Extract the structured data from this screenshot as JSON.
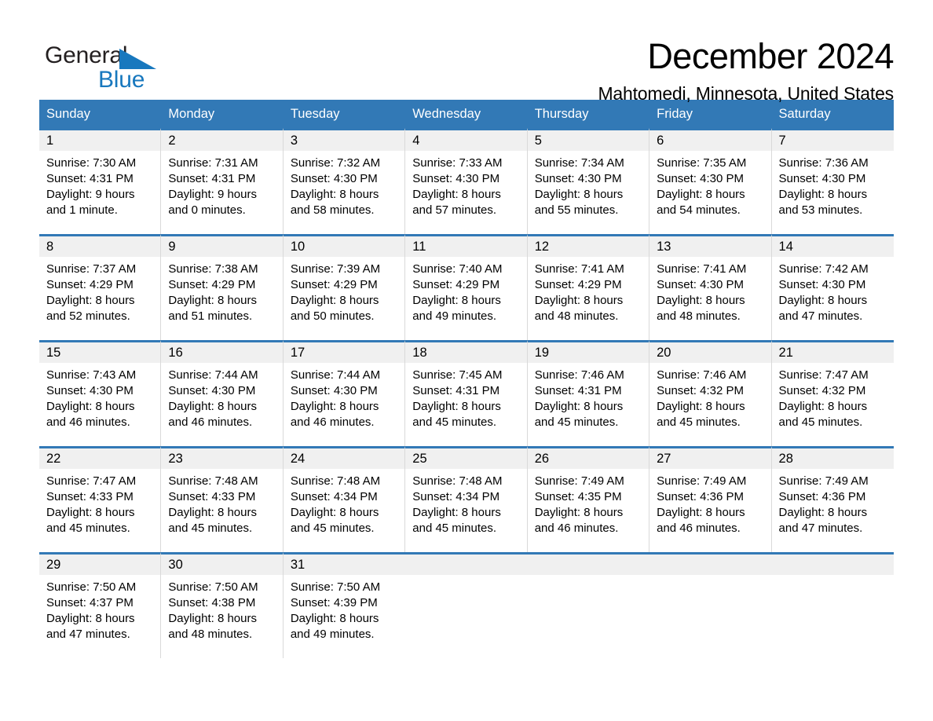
{
  "brand": {
    "name_part1": "General",
    "name_part2": "Blue",
    "logo_icon": "triangle-icon",
    "accent_color": "#1878be"
  },
  "header": {
    "month_title": "December 2024",
    "location": "Mahtomedi, Minnesota, United States"
  },
  "colors": {
    "header_blue": "#3279b6",
    "daynum_band": "#f0f0f0",
    "text": "#000000"
  },
  "calendar": {
    "weekday_headers": [
      "Sunday",
      "Monday",
      "Tuesday",
      "Wednesday",
      "Thursday",
      "Friday",
      "Saturday"
    ],
    "weeks": [
      [
        {
          "day": "1",
          "sunrise": "Sunrise: 7:30 AM",
          "sunset": "Sunset: 4:31 PM",
          "daylight_line1": "Daylight: 9 hours",
          "daylight_line2": "and 1 minute."
        },
        {
          "day": "2",
          "sunrise": "Sunrise: 7:31 AM",
          "sunset": "Sunset: 4:31 PM",
          "daylight_line1": "Daylight: 9 hours",
          "daylight_line2": "and 0 minutes."
        },
        {
          "day": "3",
          "sunrise": "Sunrise: 7:32 AM",
          "sunset": "Sunset: 4:30 PM",
          "daylight_line1": "Daylight: 8 hours",
          "daylight_line2": "and 58 minutes."
        },
        {
          "day": "4",
          "sunrise": "Sunrise: 7:33 AM",
          "sunset": "Sunset: 4:30 PM",
          "daylight_line1": "Daylight: 8 hours",
          "daylight_line2": "and 57 minutes."
        },
        {
          "day": "5",
          "sunrise": "Sunrise: 7:34 AM",
          "sunset": "Sunset: 4:30 PM",
          "daylight_line1": "Daylight: 8 hours",
          "daylight_line2": "and 55 minutes."
        },
        {
          "day": "6",
          "sunrise": "Sunrise: 7:35 AM",
          "sunset": "Sunset: 4:30 PM",
          "daylight_line1": "Daylight: 8 hours",
          "daylight_line2": "and 54 minutes."
        },
        {
          "day": "7",
          "sunrise": "Sunrise: 7:36 AM",
          "sunset": "Sunset: 4:30 PM",
          "daylight_line1": "Daylight: 8 hours",
          "daylight_line2": "and 53 minutes."
        }
      ],
      [
        {
          "day": "8",
          "sunrise": "Sunrise: 7:37 AM",
          "sunset": "Sunset: 4:29 PM",
          "daylight_line1": "Daylight: 8 hours",
          "daylight_line2": "and 52 minutes."
        },
        {
          "day": "9",
          "sunrise": "Sunrise: 7:38 AM",
          "sunset": "Sunset: 4:29 PM",
          "daylight_line1": "Daylight: 8 hours",
          "daylight_line2": "and 51 minutes."
        },
        {
          "day": "10",
          "sunrise": "Sunrise: 7:39 AM",
          "sunset": "Sunset: 4:29 PM",
          "daylight_line1": "Daylight: 8 hours",
          "daylight_line2": "and 50 minutes."
        },
        {
          "day": "11",
          "sunrise": "Sunrise: 7:40 AM",
          "sunset": "Sunset: 4:29 PM",
          "daylight_line1": "Daylight: 8 hours",
          "daylight_line2": "and 49 minutes."
        },
        {
          "day": "12",
          "sunrise": "Sunrise: 7:41 AM",
          "sunset": "Sunset: 4:29 PM",
          "daylight_line1": "Daylight: 8 hours",
          "daylight_line2": "and 48 minutes."
        },
        {
          "day": "13",
          "sunrise": "Sunrise: 7:41 AM",
          "sunset": "Sunset: 4:30 PM",
          "daylight_line1": "Daylight: 8 hours",
          "daylight_line2": "and 48 minutes."
        },
        {
          "day": "14",
          "sunrise": "Sunrise: 7:42 AM",
          "sunset": "Sunset: 4:30 PM",
          "daylight_line1": "Daylight: 8 hours",
          "daylight_line2": "and 47 minutes."
        }
      ],
      [
        {
          "day": "15",
          "sunrise": "Sunrise: 7:43 AM",
          "sunset": "Sunset: 4:30 PM",
          "daylight_line1": "Daylight: 8 hours",
          "daylight_line2": "and 46 minutes."
        },
        {
          "day": "16",
          "sunrise": "Sunrise: 7:44 AM",
          "sunset": "Sunset: 4:30 PM",
          "daylight_line1": "Daylight: 8 hours",
          "daylight_line2": "and 46 minutes."
        },
        {
          "day": "17",
          "sunrise": "Sunrise: 7:44 AM",
          "sunset": "Sunset: 4:30 PM",
          "daylight_line1": "Daylight: 8 hours",
          "daylight_line2": "and 46 minutes."
        },
        {
          "day": "18",
          "sunrise": "Sunrise: 7:45 AM",
          "sunset": "Sunset: 4:31 PM",
          "daylight_line1": "Daylight: 8 hours",
          "daylight_line2": "and 45 minutes."
        },
        {
          "day": "19",
          "sunrise": "Sunrise: 7:46 AM",
          "sunset": "Sunset: 4:31 PM",
          "daylight_line1": "Daylight: 8 hours",
          "daylight_line2": "and 45 minutes."
        },
        {
          "day": "20",
          "sunrise": "Sunrise: 7:46 AM",
          "sunset": "Sunset: 4:32 PM",
          "daylight_line1": "Daylight: 8 hours",
          "daylight_line2": "and 45 minutes."
        },
        {
          "day": "21",
          "sunrise": "Sunrise: 7:47 AM",
          "sunset": "Sunset: 4:32 PM",
          "daylight_line1": "Daylight: 8 hours",
          "daylight_line2": "and 45 minutes."
        }
      ],
      [
        {
          "day": "22",
          "sunrise": "Sunrise: 7:47 AM",
          "sunset": "Sunset: 4:33 PM",
          "daylight_line1": "Daylight: 8 hours",
          "daylight_line2": "and 45 minutes."
        },
        {
          "day": "23",
          "sunrise": "Sunrise: 7:48 AM",
          "sunset": "Sunset: 4:33 PM",
          "daylight_line1": "Daylight: 8 hours",
          "daylight_line2": "and 45 minutes."
        },
        {
          "day": "24",
          "sunrise": "Sunrise: 7:48 AM",
          "sunset": "Sunset: 4:34 PM",
          "daylight_line1": "Daylight: 8 hours",
          "daylight_line2": "and 45 minutes."
        },
        {
          "day": "25",
          "sunrise": "Sunrise: 7:48 AM",
          "sunset": "Sunset: 4:34 PM",
          "daylight_line1": "Daylight: 8 hours",
          "daylight_line2": "and 45 minutes."
        },
        {
          "day": "26",
          "sunrise": "Sunrise: 7:49 AM",
          "sunset": "Sunset: 4:35 PM",
          "daylight_line1": "Daylight: 8 hours",
          "daylight_line2": "and 46 minutes."
        },
        {
          "day": "27",
          "sunrise": "Sunrise: 7:49 AM",
          "sunset": "Sunset: 4:36 PM",
          "daylight_line1": "Daylight: 8 hours",
          "daylight_line2": "and 46 minutes."
        },
        {
          "day": "28",
          "sunrise": "Sunrise: 7:49 AM",
          "sunset": "Sunset: 4:36 PM",
          "daylight_line1": "Daylight: 8 hours",
          "daylight_line2": "and 47 minutes."
        }
      ],
      [
        {
          "day": "29",
          "sunrise": "Sunrise: 7:50 AM",
          "sunset": "Sunset: 4:37 PM",
          "daylight_line1": "Daylight: 8 hours",
          "daylight_line2": "and 47 minutes."
        },
        {
          "day": "30",
          "sunrise": "Sunrise: 7:50 AM",
          "sunset": "Sunset: 4:38 PM",
          "daylight_line1": "Daylight: 8 hours",
          "daylight_line2": "and 48 minutes."
        },
        {
          "day": "31",
          "sunrise": "Sunrise: 7:50 AM",
          "sunset": "Sunset: 4:39 PM",
          "daylight_line1": "Daylight: 8 hours",
          "daylight_line2": "and 49 minutes."
        },
        {
          "day": "",
          "sunrise": "",
          "sunset": "",
          "daylight_line1": "",
          "daylight_line2": ""
        },
        {
          "day": "",
          "sunrise": "",
          "sunset": "",
          "daylight_line1": "",
          "daylight_line2": ""
        },
        {
          "day": "",
          "sunrise": "",
          "sunset": "",
          "daylight_line1": "",
          "daylight_line2": ""
        },
        {
          "day": "",
          "sunrise": "",
          "sunset": "",
          "daylight_line1": "",
          "daylight_line2": ""
        }
      ]
    ]
  }
}
